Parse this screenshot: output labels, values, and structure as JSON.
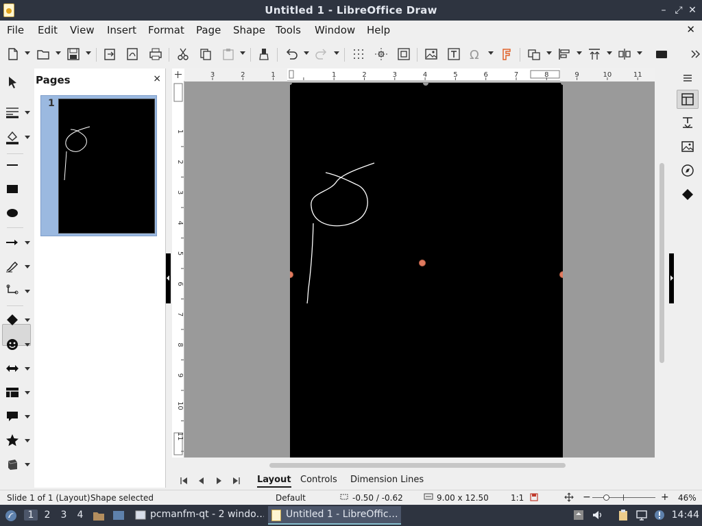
{
  "window": {
    "title": "Untitled 1 - LibreOffice Draw",
    "controls": {
      "minimize": "–",
      "maximize": "⤢",
      "close": "✕"
    }
  },
  "menubar": {
    "items": [
      "File",
      "Edit",
      "View",
      "Insert",
      "Format",
      "Page",
      "Shape",
      "Tools",
      "Window",
      "Help"
    ],
    "close_document": "✕"
  },
  "toolbar": {
    "icons": [
      "new-document-icon",
      "open-icon",
      "save-icon",
      "export-icon",
      "export-pdf-icon",
      "print-icon",
      "cut-icon",
      "copy-icon",
      "paste-icon",
      "clone-formatting-icon",
      "undo-icon",
      "redo-icon",
      "grid-icon",
      "helplines-icon",
      "zoom-page-icon",
      "insert-image-icon",
      "insert-textbox-icon",
      "special-character-icon",
      "fontwork-icon",
      "transformations-icon",
      "align-icon",
      "arrange-icon",
      "distribute-icon",
      "shadow-icon",
      "more-options-icon"
    ]
  },
  "drawing_tools": {
    "icons": [
      "select-icon",
      "line-color-icon",
      "fill-color-icon",
      "line-icon",
      "rectangle-icon",
      "ellipse-icon",
      "line-arrow-icon",
      "freeform-line-icon",
      "connector-icon",
      "basic-shapes-icon",
      "symbol-shapes-icon",
      "block-arrows-icon",
      "flowchart-icon",
      "callouts-icon",
      "stars-icon",
      "3d-objects-icon"
    ],
    "active": "freeform-line-icon"
  },
  "pages_pane": {
    "title": "Pages",
    "close": "×",
    "pages": [
      {
        "number": "1",
        "selected": true
      }
    ]
  },
  "rulers": {
    "horizontal_ticks": [
      "3",
      "2",
      "1",
      "1",
      "2",
      "3",
      "4",
      "5",
      "6",
      "7",
      "8",
      "9",
      "10",
      "11"
    ],
    "vertical_ticks": [
      "1",
      "2",
      "3",
      "4",
      "5",
      "6",
      "7",
      "8",
      "9",
      "10",
      "11"
    ]
  },
  "document": {
    "page_background": "#000000",
    "stroke_color": "#ffffff",
    "handle_color": "#e07a5f"
  },
  "tabs": {
    "items": [
      "Layout",
      "Controls",
      "Dimension Lines"
    ],
    "active": "Layout"
  },
  "sidebar": {
    "icons": [
      "sidebar-menu-icon",
      "properties-icon",
      "styles-icon",
      "gallery-icon",
      "navigator-icon",
      "shapes-icon"
    ],
    "active": "properties-icon"
  },
  "statusbar": {
    "slide_info": "Slide 1 of 1 (Layout)",
    "selection": "Shape selected",
    "master": "Default",
    "position": "-0.50 / -0.62",
    "size": "9.00 x 12.50",
    "scale": "1:1",
    "zoom_minus": "−",
    "zoom_plus": "+",
    "zoom_level": "46%"
  },
  "taskbar": {
    "workspaces": [
      "1",
      "2",
      "3",
      "4"
    ],
    "active_workspace": "1",
    "tasks": [
      {
        "label": "pcmanfm-qt - 2 windo…",
        "active": false
      },
      {
        "label": "Untitled 1 - LibreOffic…",
        "active": true
      }
    ],
    "clock": "14:44"
  }
}
